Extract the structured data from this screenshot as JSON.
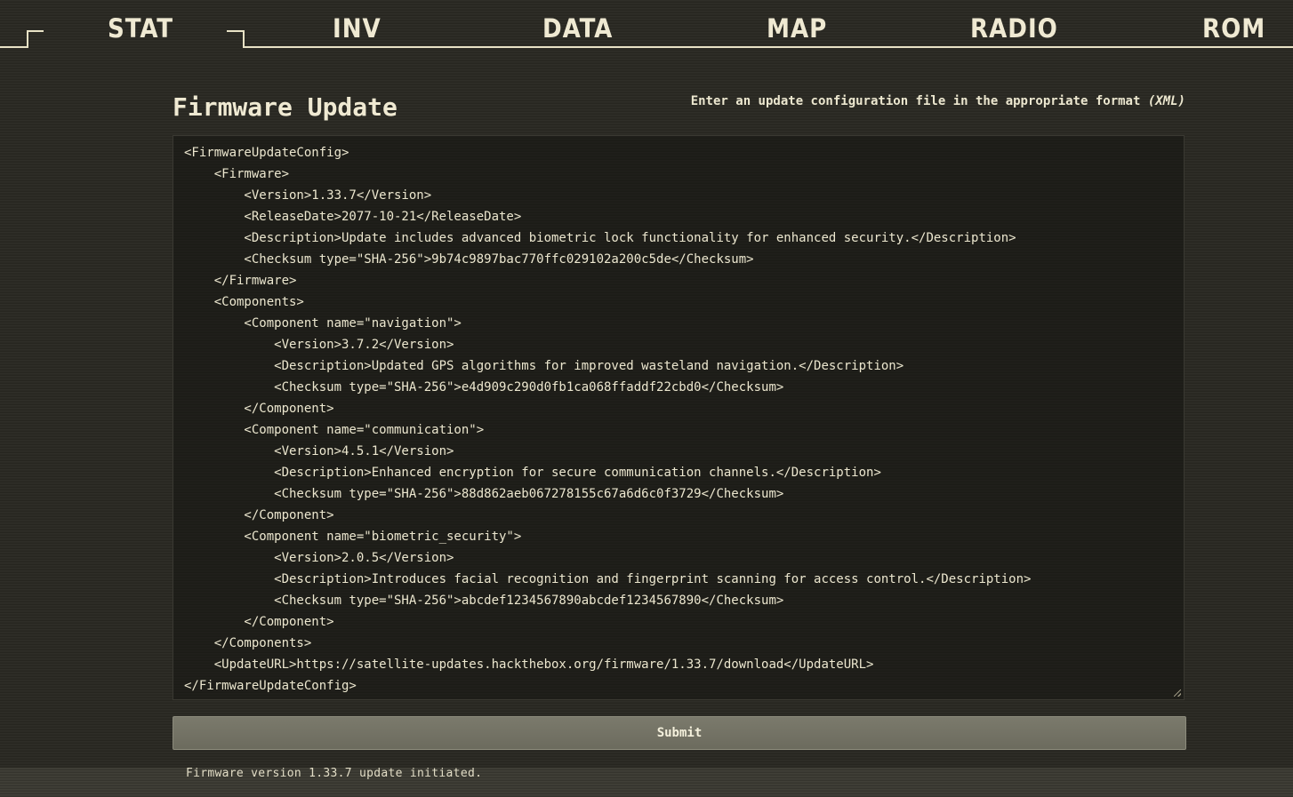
{
  "nav": {
    "tabs": [
      {
        "label": "STAT"
      },
      {
        "label": "INV"
      },
      {
        "label": "DATA"
      },
      {
        "label": "MAP"
      },
      {
        "label": "RADIO"
      },
      {
        "label": "ROM"
      }
    ]
  },
  "panel": {
    "title": "Firmware Update",
    "hint_text": "Enter an update configuration file in the appropriate format ",
    "hint_format": "(XML)"
  },
  "editor": {
    "lines": [
      "<FirmwareUpdateConfig>",
      "    <Firmware>",
      "        <Version>1.33.7</Version>",
      "        <ReleaseDate>2077-10-21</ReleaseDate>",
      "        <Description>Update includes advanced biometric lock functionality for enhanced security.</Description>",
      "        <Checksum type=\"SHA-256\">9b74c9897bac770ffc029102a200c5de</Checksum>",
      "    </Firmware>",
      "    <Components>",
      "        <Component name=\"navigation\">",
      "            <Version>3.7.2</Version>",
      "            <Description>Updated GPS algorithms for improved wasteland navigation.</Description>",
      "            <Checksum type=\"SHA-256\">e4d909c290d0fb1ca068ffaddf22cbd0</Checksum>",
      "        </Component>",
      "        <Component name=\"communication\">",
      "            <Version>4.5.1</Version>",
      "            <Description>Enhanced encryption for secure communication channels.</Description>",
      "            <Checksum type=\"SHA-256\">88d862aeb067278155c67a6d6c0f3729</Checksum>",
      "        </Component>",
      "        <Component name=\"biometric_security\">",
      "            <Version>2.0.5</Version>",
      "            <Description>Introduces facial recognition and fingerprint scanning for access control.</Description>",
      "            <Checksum type=\"SHA-256\">abcdef1234567890abcdef1234567890</Checksum>",
      "        </Component>",
      "    </Components>",
      "    <UpdateURL>https://satellite-updates.hackthebox.org/firmware/1.33.7/download</UpdateURL>",
      "</FirmwareUpdateConfig>"
    ]
  },
  "submit": {
    "label": "Submit"
  },
  "status": {
    "message": "Firmware version 1.33.7 update initiated."
  },
  "colors": {
    "background": "#2b2a24",
    "text": "#ece7cf",
    "accent_line": "#e8e2c5",
    "button": "#747365",
    "status_bar": "#3b3a32"
  }
}
